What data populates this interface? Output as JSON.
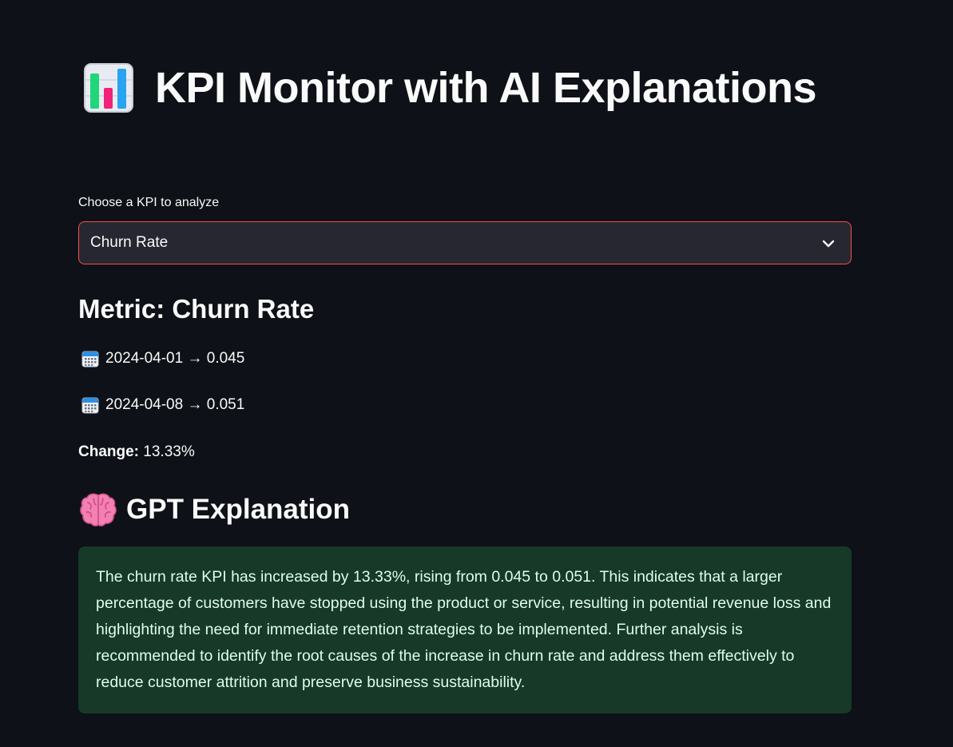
{
  "header": {
    "title": "KPI Monitor with AI Explanations",
    "title_icon": "bar-chart-icon"
  },
  "selector": {
    "label": "Choose a KPI to analyze",
    "selected": "Churn Rate",
    "icon": "chevron-down-icon"
  },
  "metric": {
    "heading": "Metric: Churn Rate",
    "entries": [
      {
        "icon": "calendar-icon",
        "text": "2024-04-01 → 0.045"
      },
      {
        "icon": "calendar-icon",
        "text": "2024-04-08 → 0.051"
      }
    ],
    "change_label": "Change:",
    "change_value": " 13.33%"
  },
  "explanation": {
    "icon": "brain-icon",
    "heading": "GPT Explanation",
    "text": "The churn rate KPI has increased by 13.33%, rising from 0.045 to 0.051. This indicates that a larger percentage of customers have stopped using the product or service, resulting in potential revenue loss and highlighting the need for immediate retention strategies to be implemented. Further analysis is recommended to identify the root causes of the increase in churn rate and address them effectively to reduce customer attrition and preserve business sustainability."
  },
  "colors": {
    "background": "#0e1117",
    "select_background": "#262730",
    "select_border": "#ff4b4b",
    "explanation_background": "#173928",
    "explanation_text": "#dffde9"
  }
}
